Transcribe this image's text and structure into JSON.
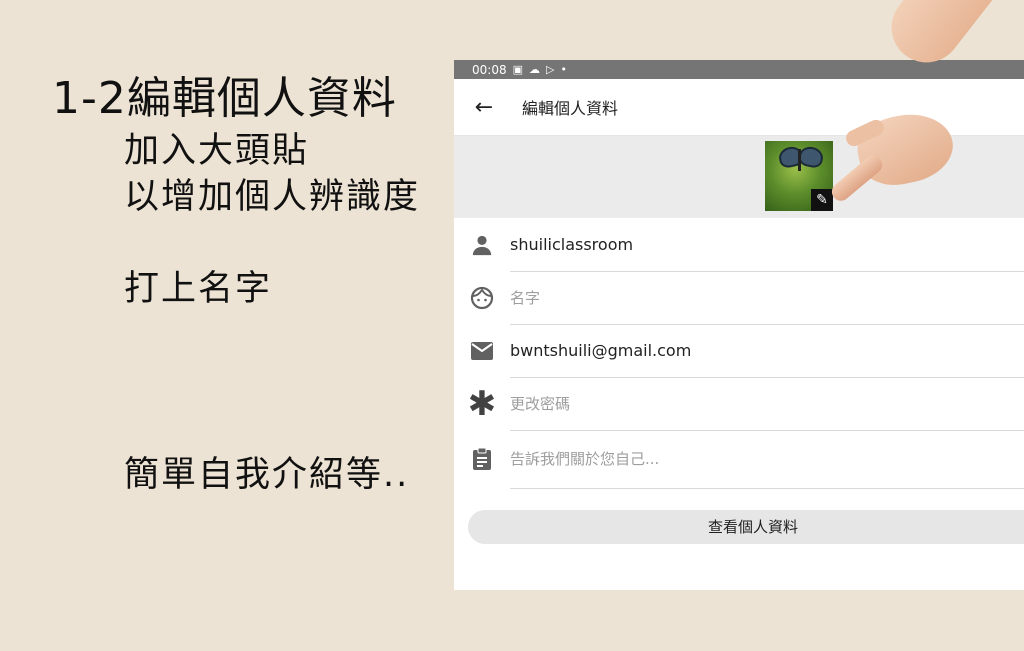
{
  "slide": {
    "title": "1-2編輯個人資料",
    "notes": [
      "加入大頭貼",
      "以增加個人辨識度",
      "打上名字",
      "簡單自我介紹等.."
    ]
  },
  "statusbar": {
    "time": "00:08",
    "icons": [
      "image-icon",
      "cloud-icon",
      "play-store-icon",
      "dot-icon"
    ]
  },
  "appbar": {
    "title": "編輯個人資料"
  },
  "profile": {
    "username": "shuiliclassroom",
    "name_placeholder": "名字",
    "email": "bwntshuili@gmail.com",
    "password_label": "更改密碼",
    "bio_placeholder": "告訴我們關於您自己..."
  },
  "actions": {
    "view_profile": "查看個人資料"
  }
}
